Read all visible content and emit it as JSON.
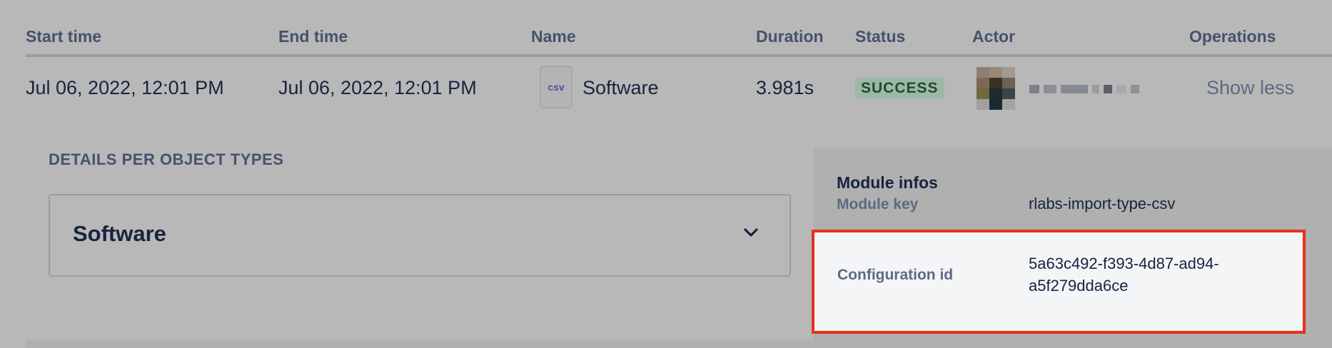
{
  "table": {
    "columns": [
      "Start time",
      "End time",
      "Name",
      "Duration",
      "Status",
      "Actor",
      "Operations"
    ],
    "row": {
      "start_time": "Jul 06, 2022, 12:01 PM",
      "end_time": "Jul 06, 2022, 12:01 PM",
      "file_type": "csv",
      "name": "Software",
      "duration": "3.981s",
      "status": "SUCCESS",
      "operation": "Show less"
    }
  },
  "details": {
    "title": "DETAILS PER OBJECT TYPES",
    "object_types": [
      "Software"
    ]
  },
  "module_infos": {
    "title": "Module infos",
    "rows": [
      {
        "label": "Module key",
        "value": "rlabs-import-type-csv"
      },
      {
        "label": "Configuration id",
        "value_lines": [
          "5a63c492-f393-4d87-ad94-",
          "a5f279dda6ce"
        ]
      }
    ]
  },
  "colors": {
    "highlight_border": "#e8301f",
    "success_badge_bg": "#9eb8a6",
    "success_badge_text": "#1e4d2e",
    "csv_icon_text": "#5c4a99"
  },
  "icons": [
    "csv-file-icon",
    "chevron-down-icon"
  ]
}
